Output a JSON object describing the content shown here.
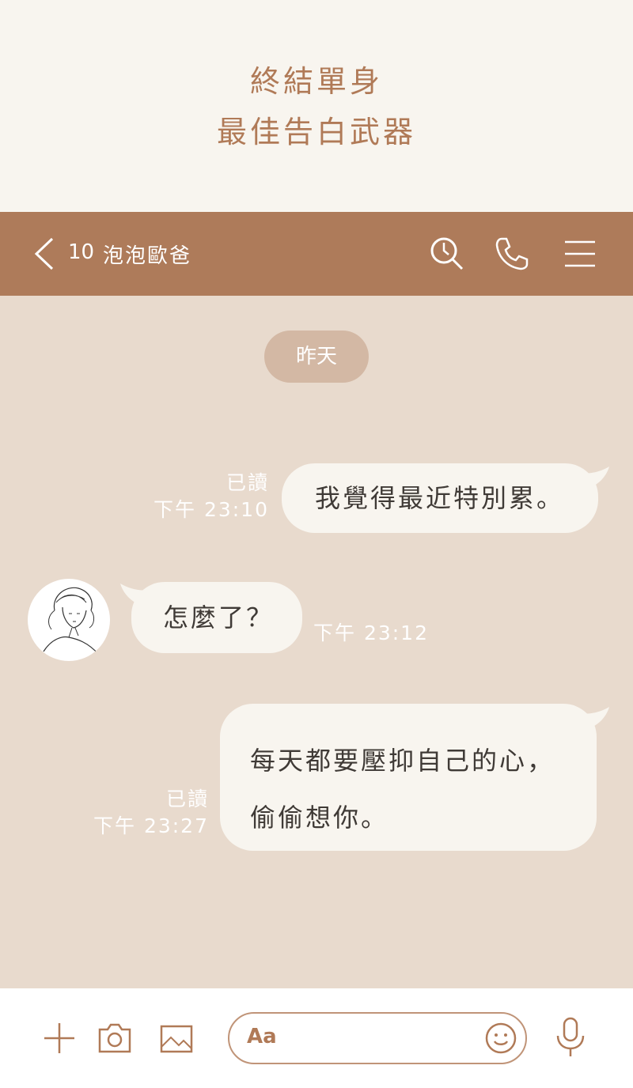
{
  "banner": {
    "line1": "終結單身",
    "line2": "最佳告白武器"
  },
  "header": {
    "count": "10",
    "name": "泡泡歐爸"
  },
  "chat": {
    "date": "昨天",
    "messages": [
      {
        "side": "right",
        "text": "我覺得最近特別累。",
        "status": "已讀",
        "time": "下午 23:10"
      },
      {
        "side": "left",
        "text": "怎麼了？",
        "time": "下午 23:12"
      },
      {
        "side": "right",
        "line1": "每天都要壓抑自己的心，",
        "line2": "偷偷想你。",
        "status": "已讀",
        "time": "下午 23:27"
      }
    ]
  },
  "input": {
    "placeholder": "Aa"
  },
  "colors": {
    "banner_bg": "#f8f5ef",
    "accent": "#ae7b5a",
    "chat_bg": "#e8dacd",
    "bubble": "#f8f5ef",
    "pill": "#d3b8a4"
  }
}
